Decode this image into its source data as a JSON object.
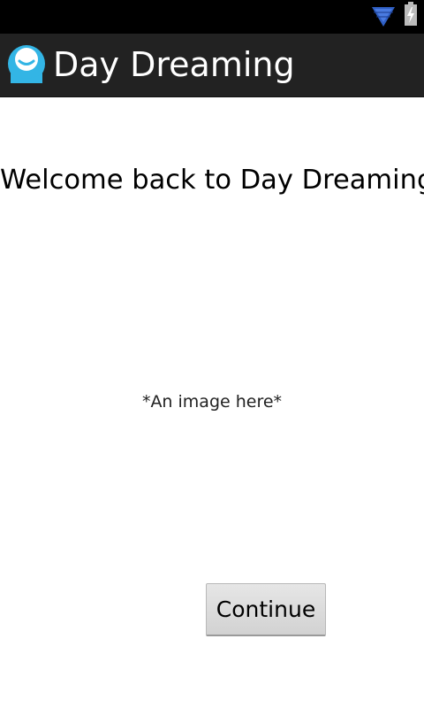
{
  "status_bar": {
    "icons": [
      "wifi-icon",
      "battery-charging-icon"
    ]
  },
  "action_bar": {
    "app_icon": "day-dreaming-app-icon",
    "title": "Day Dreaming",
    "background_color": "#222222"
  },
  "content": {
    "welcome_text": "Welcome back to Day Dreaming!",
    "image_placeholder_text": "*An image here*",
    "continue_label": "Continue"
  },
  "colors": {
    "wifi_blue": "#3f6fd4",
    "app_icon_blue": "#33b5e5"
  }
}
